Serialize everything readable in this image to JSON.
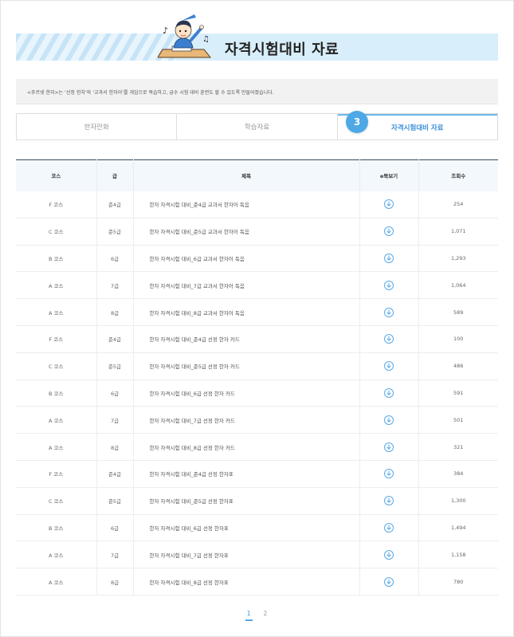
{
  "banner": {
    "title": "자격시험대비 자료"
  },
  "intro": {
    "text": "<푸르넷 한자>는 ‘선정 한자’와 ‘교과서 한자어’를 게임으로 복습하고, 급수 시험 대비 훈련도 할 수 있도록 만들어졌습니다."
  },
  "tabs": [
    {
      "label": "한자만화"
    },
    {
      "label": "학습자료"
    },
    {
      "label": "자격시험대비 자료",
      "number": "3"
    }
  ],
  "table": {
    "headers": [
      "코스",
      "급",
      "제목",
      "e북보기",
      "조회수"
    ],
    "rows": [
      {
        "course": "F 코스",
        "grade": "준4급",
        "title": "한자 자격시험 대비_준4급 교과서 한자어 독음",
        "views": "254"
      },
      {
        "course": "C 코스",
        "grade": "준5급",
        "title": "한자 자격시험 대비_준5급 교과서 한자어 독음",
        "views": "1,071"
      },
      {
        "course": "B 코스",
        "grade": "6급",
        "title": "한자 자격시험 대비_6급 교과서 한자어 독음",
        "views": "1,293"
      },
      {
        "course": "A 코스",
        "grade": "7급",
        "title": "한자 자격시험 대비_7급 교과서 한자어 독음",
        "views": "1,064"
      },
      {
        "course": "A 코스",
        "grade": "8급",
        "title": "한자 자격시험 대비_8급 교과서 한자어 독음",
        "views": "589"
      },
      {
        "course": "F 코스",
        "grade": "준4급",
        "title": "한자 자격시험 대비_준4급 선정 한자 카드",
        "views": "100"
      },
      {
        "course": "C 코스",
        "grade": "준5급",
        "title": "한자 자격시험 대비_준5급 선정 한자 카드",
        "views": "486"
      },
      {
        "course": "B 코스",
        "grade": "6급",
        "title": "한자 자격시험 대비_6급 선정 한자 카드",
        "views": "591"
      },
      {
        "course": "A 코스",
        "grade": "7급",
        "title": "한자 자격시험 대비_7급 선정 한자 카드",
        "views": "501"
      },
      {
        "course": "A 코스",
        "grade": "8급",
        "title": "한자 자격시험 대비_8급 선정 한자 카드",
        "views": "321"
      },
      {
        "course": "F 코스",
        "grade": "준4급",
        "title": "한자 자격시험 대비_준4급 선정 한자표",
        "views": "384"
      },
      {
        "course": "C 코스",
        "grade": "준5급",
        "title": "한자 자격시험 대비_준5급 선정 한자표",
        "views": "1,300"
      },
      {
        "course": "B 코스",
        "grade": "6급",
        "title": "한자 자격시험 대비_6급 선정 한자표",
        "views": "1,494"
      },
      {
        "course": "A 코스",
        "grade": "7급",
        "title": "한자 자격시험 대비_7급 선정 한자표",
        "views": "1,158"
      },
      {
        "course": "A 코스",
        "grade": "8급",
        "title": "한자 자격시험 대비_8급 선정 한자표",
        "views": "780"
      }
    ]
  },
  "pagination": {
    "pages": [
      "1",
      "2"
    ],
    "current": "1"
  },
  "colors": {
    "accent": "#4ea8e6",
    "banner_bg": "#d9eefb",
    "header_bg": "#f3f8fd"
  },
  "icons": {
    "download": "download-circle-icon",
    "mascot": "student-mascot-icon"
  }
}
